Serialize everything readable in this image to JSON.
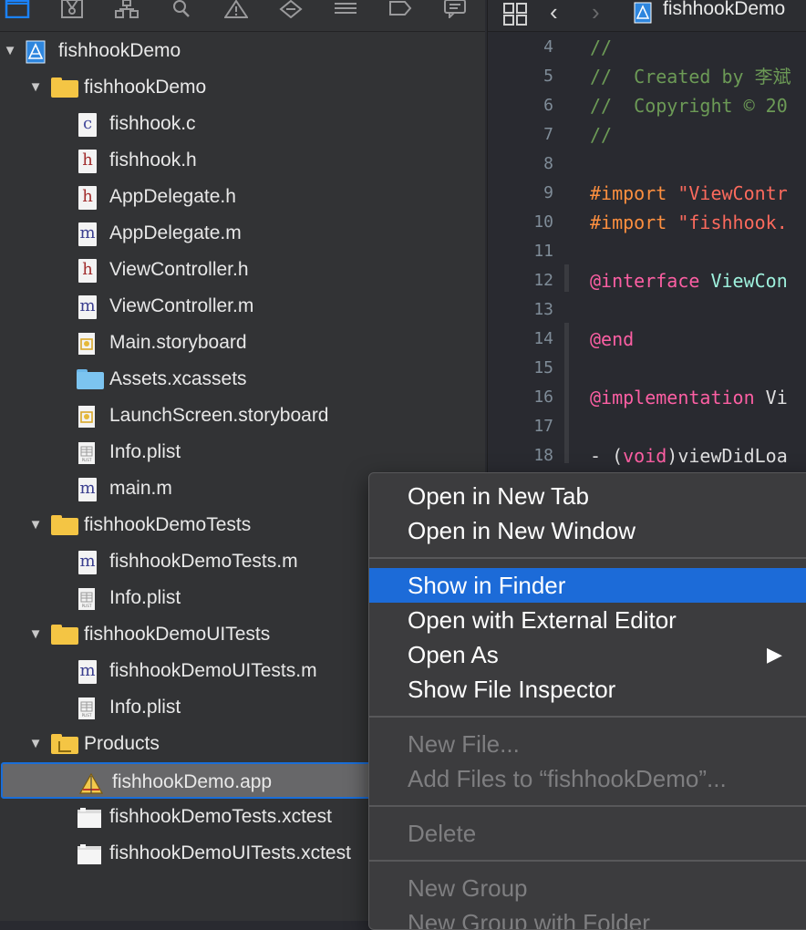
{
  "navigator": {
    "toolbar_icons": [
      "folder-icon",
      "source-control-icon",
      "hierarchy-icon",
      "search-icon",
      "warning-icon",
      "test-diamond-icon",
      "debug-list-icon",
      "breakpoint-icon",
      "report-icon"
    ],
    "tree": [
      {
        "label": "fishhookDemo",
        "icon": "project-icon",
        "indent": 0,
        "expanded": true
      },
      {
        "label": "fishhookDemo",
        "icon": "folder-icon",
        "indent": 1,
        "expanded": true
      },
      {
        "label": "fishhook.c",
        "icon": "c-file-icon",
        "indent": 2
      },
      {
        "label": "fishhook.h",
        "icon": "h-file-icon",
        "indent": 2
      },
      {
        "label": "AppDelegate.h",
        "icon": "h-file-icon",
        "indent": 2
      },
      {
        "label": "AppDelegate.m",
        "icon": "m-file-icon",
        "indent": 2
      },
      {
        "label": "ViewController.h",
        "icon": "h-file-icon",
        "indent": 2
      },
      {
        "label": "ViewController.m",
        "icon": "m-file-icon",
        "indent": 2
      },
      {
        "label": "Main.storyboard",
        "icon": "storyboard-icon",
        "indent": 2
      },
      {
        "label": "Assets.xcassets",
        "icon": "assets-folder-icon",
        "indent": 2
      },
      {
        "label": "LaunchScreen.storyboard",
        "icon": "storyboard-icon",
        "indent": 2
      },
      {
        "label": "Info.plist",
        "icon": "plist-icon",
        "indent": 2
      },
      {
        "label": "main.m",
        "icon": "m-file-icon",
        "indent": 2
      },
      {
        "label": "fishhookDemoTests",
        "icon": "folder-icon",
        "indent": 1,
        "expanded": true
      },
      {
        "label": "fishhookDemoTests.m",
        "icon": "m-file-icon",
        "indent": 2
      },
      {
        "label": "Info.plist",
        "icon": "plist-icon",
        "indent": 2
      },
      {
        "label": "fishhookDemoUITests",
        "icon": "folder-icon",
        "indent": 1,
        "expanded": true
      },
      {
        "label": "fishhookDemoUITests.m",
        "icon": "m-file-icon",
        "indent": 2
      },
      {
        "label": "Info.plist",
        "icon": "plist-icon",
        "indent": 2
      },
      {
        "label": "Products",
        "icon": "products-folder-icon",
        "indent": 1,
        "expanded": true
      },
      {
        "label": "fishhookDemo.app",
        "icon": "app-icon",
        "indent": 2,
        "selected": true
      },
      {
        "label": "fishhookDemoTests.xctest",
        "icon": "bundle-icon",
        "indent": 2
      },
      {
        "label": "fishhookDemoUITests.xctest",
        "icon": "bundle-icon",
        "indent": 2
      }
    ]
  },
  "editor": {
    "breadcrumb_file": "fishhookDemo",
    "lines": [
      {
        "n": "4",
        "parts": [
          {
            "t": "//",
            "c": "c-com"
          }
        ]
      },
      {
        "n": "5",
        "parts": [
          {
            "t": "//  Created by 李斌",
            "c": "c-com"
          }
        ]
      },
      {
        "n": "6",
        "parts": [
          {
            "t": "//  Copyright © 20",
            "c": "c-com"
          }
        ]
      },
      {
        "n": "7",
        "parts": [
          {
            "t": "//",
            "c": "c-com"
          }
        ]
      },
      {
        "n": "8",
        "parts": []
      },
      {
        "n": "9",
        "parts": [
          {
            "t": "#import ",
            "c": "c-pre"
          },
          {
            "t": "\"ViewContr",
            "c": "c-str"
          }
        ]
      },
      {
        "n": "10",
        "parts": [
          {
            "t": "#import ",
            "c": "c-pre"
          },
          {
            "t": "\"fishhook.",
            "c": "c-str"
          }
        ]
      },
      {
        "n": "11",
        "parts": []
      },
      {
        "n": "12",
        "parts": [
          {
            "t": "@interface ",
            "c": "c-kw"
          },
          {
            "t": "ViewCon",
            "c": "c-ty"
          }
        ]
      },
      {
        "n": "13",
        "parts": []
      },
      {
        "n": "14",
        "parts": [
          {
            "t": "@end",
            "c": "c-kw"
          }
        ]
      },
      {
        "n": "15",
        "parts": []
      },
      {
        "n": "16",
        "parts": [
          {
            "t": "@implementation ",
            "c": "c-kw"
          },
          {
            "t": "Vi",
            "c": "c-pl"
          }
        ]
      },
      {
        "n": "17",
        "parts": []
      },
      {
        "n": "18",
        "parts": [
          {
            "t": "- (",
            "c": "c-pl"
          },
          {
            "t": "void",
            "c": "c-kw"
          },
          {
            "t": ")viewDidLoa",
            "c": "c-pl"
          }
        ]
      }
    ]
  },
  "context_menu": {
    "groups": [
      [
        {
          "label": "Open in New Tab"
        },
        {
          "label": "Open in New Window"
        }
      ],
      [
        {
          "label": "Show in Finder",
          "highlighted": true
        },
        {
          "label": "Open with External Editor"
        },
        {
          "label": "Open As",
          "submenu": true
        },
        {
          "label": "Show File Inspector"
        }
      ],
      [
        {
          "label": "New File...",
          "disabled": true
        },
        {
          "label": "Add Files to “fishhookDemo”...",
          "disabled": true
        }
      ],
      [
        {
          "label": "Delete",
          "disabled": true
        }
      ],
      [
        {
          "label": "New Group",
          "disabled": true
        },
        {
          "label": "New Group with Folder",
          "disabled": true
        }
      ]
    ]
  }
}
